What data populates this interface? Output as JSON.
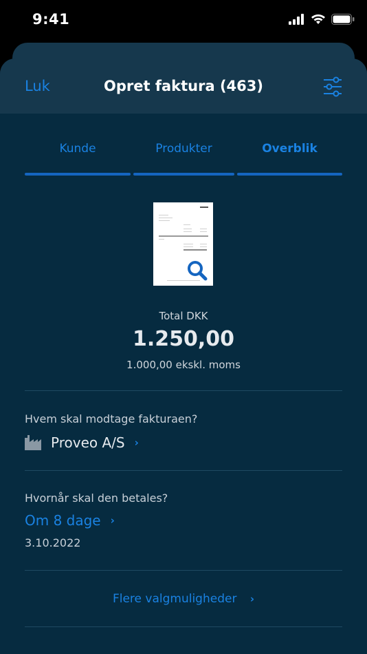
{
  "status_bar": {
    "time": "9:41",
    "icons": [
      "signal-icon",
      "wifi-icon",
      "battery-icon"
    ]
  },
  "nav": {
    "close_label": "Luk",
    "title": "Opret faktura (463)",
    "filter_icon": "sliders-icon"
  },
  "tabs": [
    {
      "label": "Kunde",
      "active": false
    },
    {
      "label": "Produkter",
      "active": false
    },
    {
      "label": "Overblik",
      "active": true
    }
  ],
  "summary": {
    "total_label": "Total DKK",
    "total_amount": "1.250,00",
    "subtotal_text": "1.000,00 ekskl. moms"
  },
  "recipient": {
    "question": "Hvem skal modtage fakturaen?",
    "name": "Proveo A/S",
    "icon": "factory-icon"
  },
  "payment": {
    "question": "Hvornår skal den betales?",
    "term": "Om 8 dage",
    "date": "3.10.2022"
  },
  "more_options": {
    "label": "Flere valgmuligheder"
  },
  "colors": {
    "background": "#062b40",
    "header": "#16384d",
    "accent": "#1a82e2",
    "tab_indicator": "#1565c0"
  }
}
